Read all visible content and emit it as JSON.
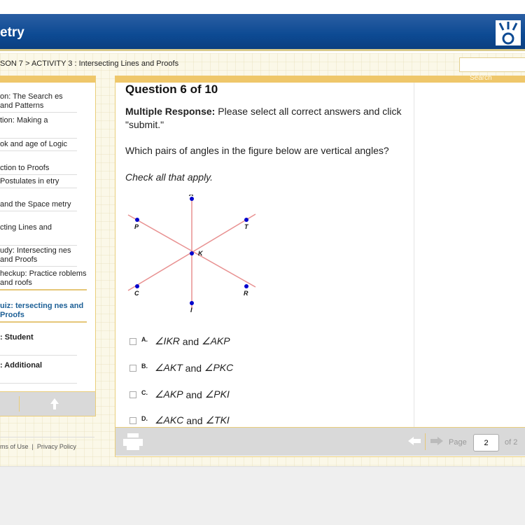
{
  "header": {
    "title": "etry",
    "logo": "brand-logo"
  },
  "breadcrumb": "SON 7 > ACTIVITY 3 : Intersecting Lines and Proofs",
  "search": {
    "label": "Search",
    "value": ""
  },
  "sidebar": {
    "items": [
      {
        "label": "on: The Search es and Patterns",
        "style": "normal"
      },
      {
        "label": "tion: Making a",
        "style": "normal"
      },
      {
        "label": "ok and age of Logic",
        "style": "normal"
      },
      {
        "label": "ction to Proofs",
        "style": "normal"
      },
      {
        "label": "Postulates in etry",
        "style": "normal"
      },
      {
        "label": " and the Space metry",
        "style": "normal"
      },
      {
        "label": "cting Lines and",
        "style": "normal"
      },
      {
        "label": "udy: Intersecting nes and Proofs",
        "style": "normal"
      },
      {
        "label": "heckup: Practice roblems and roofs",
        "style": "normal"
      },
      {
        "label": "uiz: tersecting nes and Proofs",
        "style": "current"
      },
      {
        "label": ": Student",
        "style": "bold"
      },
      {
        "label": ": Additional",
        "style": "bold"
      }
    ],
    "footer_icons": [
      "up-arrow-icon"
    ]
  },
  "footer_links": [
    "ms of Use",
    "Privacy Policy"
  ],
  "question": {
    "number": "Question 6 of 10",
    "type_label": "Multiple Response:",
    "instructions": "Please select all correct answers and click \"submit.\"",
    "prompt": "Which pairs of angles in the figure below are vertical angles?",
    "check": "Check all that apply.",
    "figure_points": [
      "A",
      "P",
      "T",
      "K",
      "C",
      "R",
      "I"
    ],
    "options": [
      {
        "letter": "A.",
        "a": "∠IKR",
        "b": "∠AKP",
        "checked": false
      },
      {
        "letter": "B.",
        "a": "∠AKT",
        "b": "∠PKC",
        "checked": false
      },
      {
        "letter": "C.",
        "a": "∠AKP",
        "b": "∠PKI",
        "checked": false
      },
      {
        "letter": "D.",
        "a": "∠AKC",
        "b": "∠TKI",
        "checked": false
      }
    ],
    "and": "and"
  },
  "pager": {
    "label": "Page",
    "value": "2",
    "of": "of 2"
  },
  "colors": {
    "header": "#0d4a93",
    "accent": "#efc76a",
    "line": "#e89090",
    "point": "#0000cc",
    "current": "#1c5f96"
  }
}
